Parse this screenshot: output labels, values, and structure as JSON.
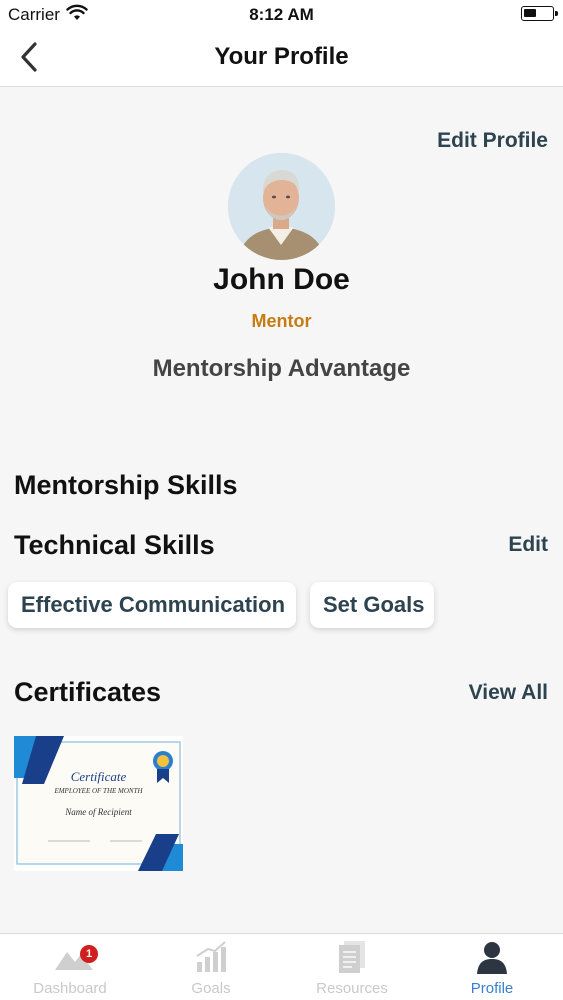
{
  "status_bar": {
    "carrier": "Carrier",
    "time": "8:12 AM"
  },
  "nav": {
    "title": "Your Profile"
  },
  "profile": {
    "edit_label": "Edit Profile",
    "name": "John Doe",
    "role": "Mentor",
    "program": "Mentorship Advantage"
  },
  "sections": {
    "mentorship_skills": "Mentorship Skills",
    "technical_skills": "Technical Skills",
    "technical_edit": "Edit",
    "certificates": "Certificates",
    "certificates_view_all": "View All"
  },
  "skills": [
    "Effective Communication",
    "Set Goals"
  ],
  "certificate": {
    "title": "Certificate",
    "subtitle": "EMPLOYEE OF THE MONTH",
    "recipient": "Name of Recipient"
  },
  "tabs": [
    {
      "label": "Dashboard",
      "icon": "dashboard-icon",
      "badge": "1"
    },
    {
      "label": "Goals",
      "icon": "bar-chart-icon"
    },
    {
      "label": "Resources",
      "icon": "document-icon"
    },
    {
      "label": "Profile",
      "icon": "person-icon",
      "active": true
    }
  ],
  "colors": {
    "accent": "#2d4350",
    "role": "#c57c12",
    "active_tab": "#3a7fcf",
    "badge": "#d01f1f"
  }
}
